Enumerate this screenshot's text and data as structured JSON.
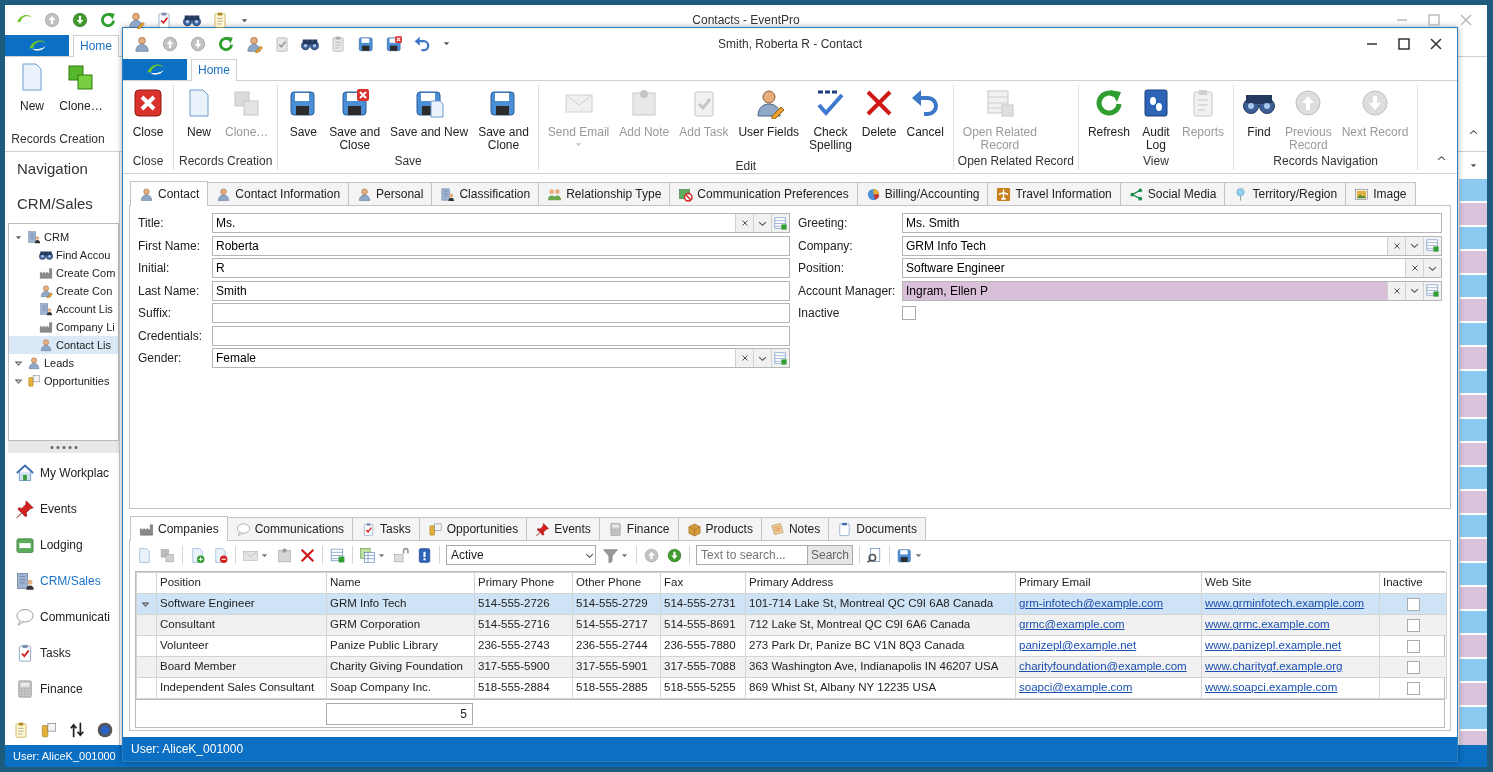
{
  "main_window": {
    "title": "Contacts - EventPro",
    "tab": "Home",
    "ribbon": {
      "buttons": [
        {
          "label": "New"
        },
        {
          "label": "Clone…"
        }
      ],
      "group": "Records Creation"
    },
    "navigation": {
      "title": "Navigation",
      "section": "CRM/Sales",
      "tree": [
        {
          "label": "CRM",
          "expanded": true,
          "selected": false,
          "children": [
            {
              "label": "Find Accou",
              "selected": false
            },
            {
              "label": "Create Com",
              "selected": false
            },
            {
              "label": "Create Con",
              "selected": false
            },
            {
              "label": "Account Lis",
              "selected": false
            },
            {
              "label": "Company Li",
              "selected": false
            },
            {
              "label": "Contact Lis",
              "selected": true
            }
          ]
        },
        {
          "label": "Leads",
          "expanded": false,
          "selected": false
        },
        {
          "label": "Opportunities",
          "expanded": false,
          "selected": false
        }
      ],
      "items": [
        {
          "label": "My Workplac",
          "selected": false
        },
        {
          "label": "Events",
          "selected": false
        },
        {
          "label": "Lodging",
          "selected": false
        },
        {
          "label": "CRM/Sales",
          "selected": true
        },
        {
          "label": "Communicati",
          "selected": false
        },
        {
          "label": "Tasks",
          "selected": false
        },
        {
          "label": "Finance",
          "selected": false
        }
      ]
    },
    "status": "User: AliceK_001000"
  },
  "contact_window": {
    "title": "Smith, Roberta R - Contact",
    "tab": "Home",
    "ribbon_groups": [
      {
        "label": "Close",
        "buttons": [
          {
            "label": "Close",
            "disabled": false,
            "dropdown": false
          }
        ]
      },
      {
        "label": "Records Creation",
        "buttons": [
          {
            "label": "New",
            "disabled": false,
            "dropdown": false
          },
          {
            "label": "Clone…",
            "disabled": true,
            "dropdown": false
          }
        ]
      },
      {
        "label": "Save",
        "buttons": [
          {
            "label": "Save",
            "disabled": false,
            "dropdown": false
          },
          {
            "label": "Save and\nClose",
            "disabled": false,
            "dropdown": false
          },
          {
            "label": "Save and New",
            "disabled": false,
            "dropdown": false
          },
          {
            "label": "Save and\nClone",
            "disabled": false,
            "dropdown": false
          }
        ]
      },
      {
        "label": "Edit",
        "buttons": [
          {
            "label": "Send Email",
            "disabled": true,
            "dropdown": true
          },
          {
            "label": "Add Note",
            "disabled": true,
            "dropdown": false
          },
          {
            "label": "Add Task",
            "disabled": true,
            "dropdown": false
          },
          {
            "label": "User Fields",
            "disabled": false,
            "dropdown": false
          },
          {
            "label": "Check\nSpelling",
            "disabled": false,
            "dropdown": false
          },
          {
            "label": "Delete",
            "disabled": false,
            "dropdown": false
          },
          {
            "label": "Cancel",
            "disabled": false,
            "dropdown": false
          }
        ]
      },
      {
        "label": "Open Related Record",
        "buttons": [
          {
            "label": "Open Related\nRecord",
            "disabled": true,
            "dropdown": false
          }
        ]
      },
      {
        "label": "View",
        "buttons": [
          {
            "label": "Refresh",
            "disabled": false,
            "dropdown": false
          },
          {
            "label": "Audit\nLog",
            "disabled": false,
            "dropdown": false
          },
          {
            "label": "Reports",
            "disabled": true,
            "dropdown": false
          }
        ]
      },
      {
        "label": "Records Navigation",
        "buttons": [
          {
            "label": "Find",
            "disabled": false,
            "dropdown": false
          },
          {
            "label": "Previous\nRecord",
            "disabled": true,
            "dropdown": false
          },
          {
            "label": "Next Record",
            "disabled": true,
            "dropdown": false
          }
        ]
      }
    ],
    "record_tabs": [
      {
        "label": "Contact",
        "selected": true
      },
      {
        "label": "Contact Information",
        "selected": false
      },
      {
        "label": "Personal",
        "selected": false
      },
      {
        "label": "Classification",
        "selected": false
      },
      {
        "label": "Relationship Type",
        "selected": false
      },
      {
        "label": "Communication Preferences",
        "selected": false
      },
      {
        "label": "Billing/Accounting",
        "selected": false
      },
      {
        "label": "Travel Information",
        "selected": false
      },
      {
        "label": "Social Media",
        "selected": false
      },
      {
        "label": "Territory/Region",
        "selected": false
      },
      {
        "label": "Image",
        "selected": false
      }
    ],
    "form": {
      "left": [
        {
          "label": "Title:",
          "value": "Ms.",
          "kind": "lookup"
        },
        {
          "label": "First Name:",
          "value": "Roberta",
          "kind": "text"
        },
        {
          "label": "Initial:",
          "value": "R",
          "kind": "text"
        },
        {
          "label": "Last Name:",
          "value": "Smith",
          "kind": "text"
        },
        {
          "label": "Suffix:",
          "kind": "text"
        },
        {
          "label": "Credentials:",
          "kind": "text"
        },
        {
          "label": "Gender:",
          "value": "Female",
          "kind": "lookup"
        }
      ],
      "right": [
        {
          "label": "Greeting:",
          "value": "Ms. Smith",
          "kind": "text",
          "highlighted": false
        },
        {
          "label": "Company:",
          "value": "GRM Info Tech",
          "kind": "lookup",
          "highlighted": false
        },
        {
          "label": "Position:",
          "value": "Software Engineer",
          "kind": "dropdown",
          "highlighted": false
        },
        {
          "label": "Account Manager:",
          "value": "Ingram, Ellen P",
          "kind": "lookup",
          "highlighted": true
        },
        {
          "label": "Inactive",
          "kind": "checkbox",
          "checked": false,
          "highlighted": false
        }
      ]
    },
    "related_tabs": [
      {
        "label": "Companies",
        "selected": true
      },
      {
        "label": "Communications",
        "selected": false
      },
      {
        "label": "Tasks",
        "selected": false
      },
      {
        "label": "Opportunities",
        "selected": false
      },
      {
        "label": "Events",
        "selected": false
      },
      {
        "label": "Finance",
        "selected": false
      },
      {
        "label": "Products",
        "selected": false
      },
      {
        "label": "Notes",
        "selected": false
      },
      {
        "label": "Documents",
        "selected": false
      }
    ],
    "grid_toolbar": {
      "filter": "Active",
      "search_placeholder": "Text to search...",
      "search_button": "Search"
    },
    "grid": {
      "columns": [
        {
          "label": "Position",
          "kind": "text"
        },
        {
          "label": "Name",
          "kind": "text"
        },
        {
          "label": "Primary Phone",
          "kind": "text"
        },
        {
          "label": "Other Phone",
          "kind": "text"
        },
        {
          "label": "Fax",
          "kind": "text"
        },
        {
          "label": "Primary Address",
          "kind": "text"
        },
        {
          "label": "Primary Email",
          "kind": "link"
        },
        {
          "label": "Web Site",
          "kind": "link"
        },
        {
          "label": "Inactive",
          "kind": "checkbox"
        }
      ],
      "rows": [
        {
          "selected": true,
          "cells": [
            "Software Engineer",
            "GRM Info Tech",
            "514-555-2726",
            "514-555-2729",
            "514-555-2731",
            "101-714 Lake St, Montreal QC C9I 6A8 Canada",
            "grm-infotech@example.com",
            "www.grminfotech.example.com",
            false
          ]
        },
        {
          "selected": false,
          "cells": [
            "Consultant",
            "GRM Corporation",
            "514-555-2716",
            "514-555-2717",
            "514-555-8691",
            "712 Lake St, Montreal QC C9I 6A6 Canada",
            "grmc@example.com",
            "www.grmc.example.com",
            false
          ]
        },
        {
          "selected": false,
          "cells": [
            "Volunteer",
            "Panize Public Library",
            "236-555-2743",
            "236-555-2744",
            "236-555-7880",
            "273 Park Dr, Panize BC V1N 8Q3 Canada",
            "panizepl@example.net",
            "www.panizepl.example.net",
            false
          ]
        },
        {
          "selected": false,
          "cells": [
            "Board Member",
            "Charity Giving Foundation",
            "317-555-5900",
            "317-555-5901",
            "317-555-7088",
            "363 Washington Ave, Indianapolis IN 46207 USA",
            "charityfoundation@example.com",
            "www.charitygf.example.org",
            false
          ]
        },
        {
          "selected": false,
          "cells": [
            "Independent Sales Consultant",
            "Soap Company Inc.",
            "518-555-2884",
            "518-555-2885",
            "518-555-5255",
            "869 Whist St, Albany NY 12235 USA",
            "soapci@example.com",
            "www.soapci.example.com",
            false
          ]
        }
      ],
      "count": "5"
    },
    "status": "User: AliceK_001000"
  }
}
